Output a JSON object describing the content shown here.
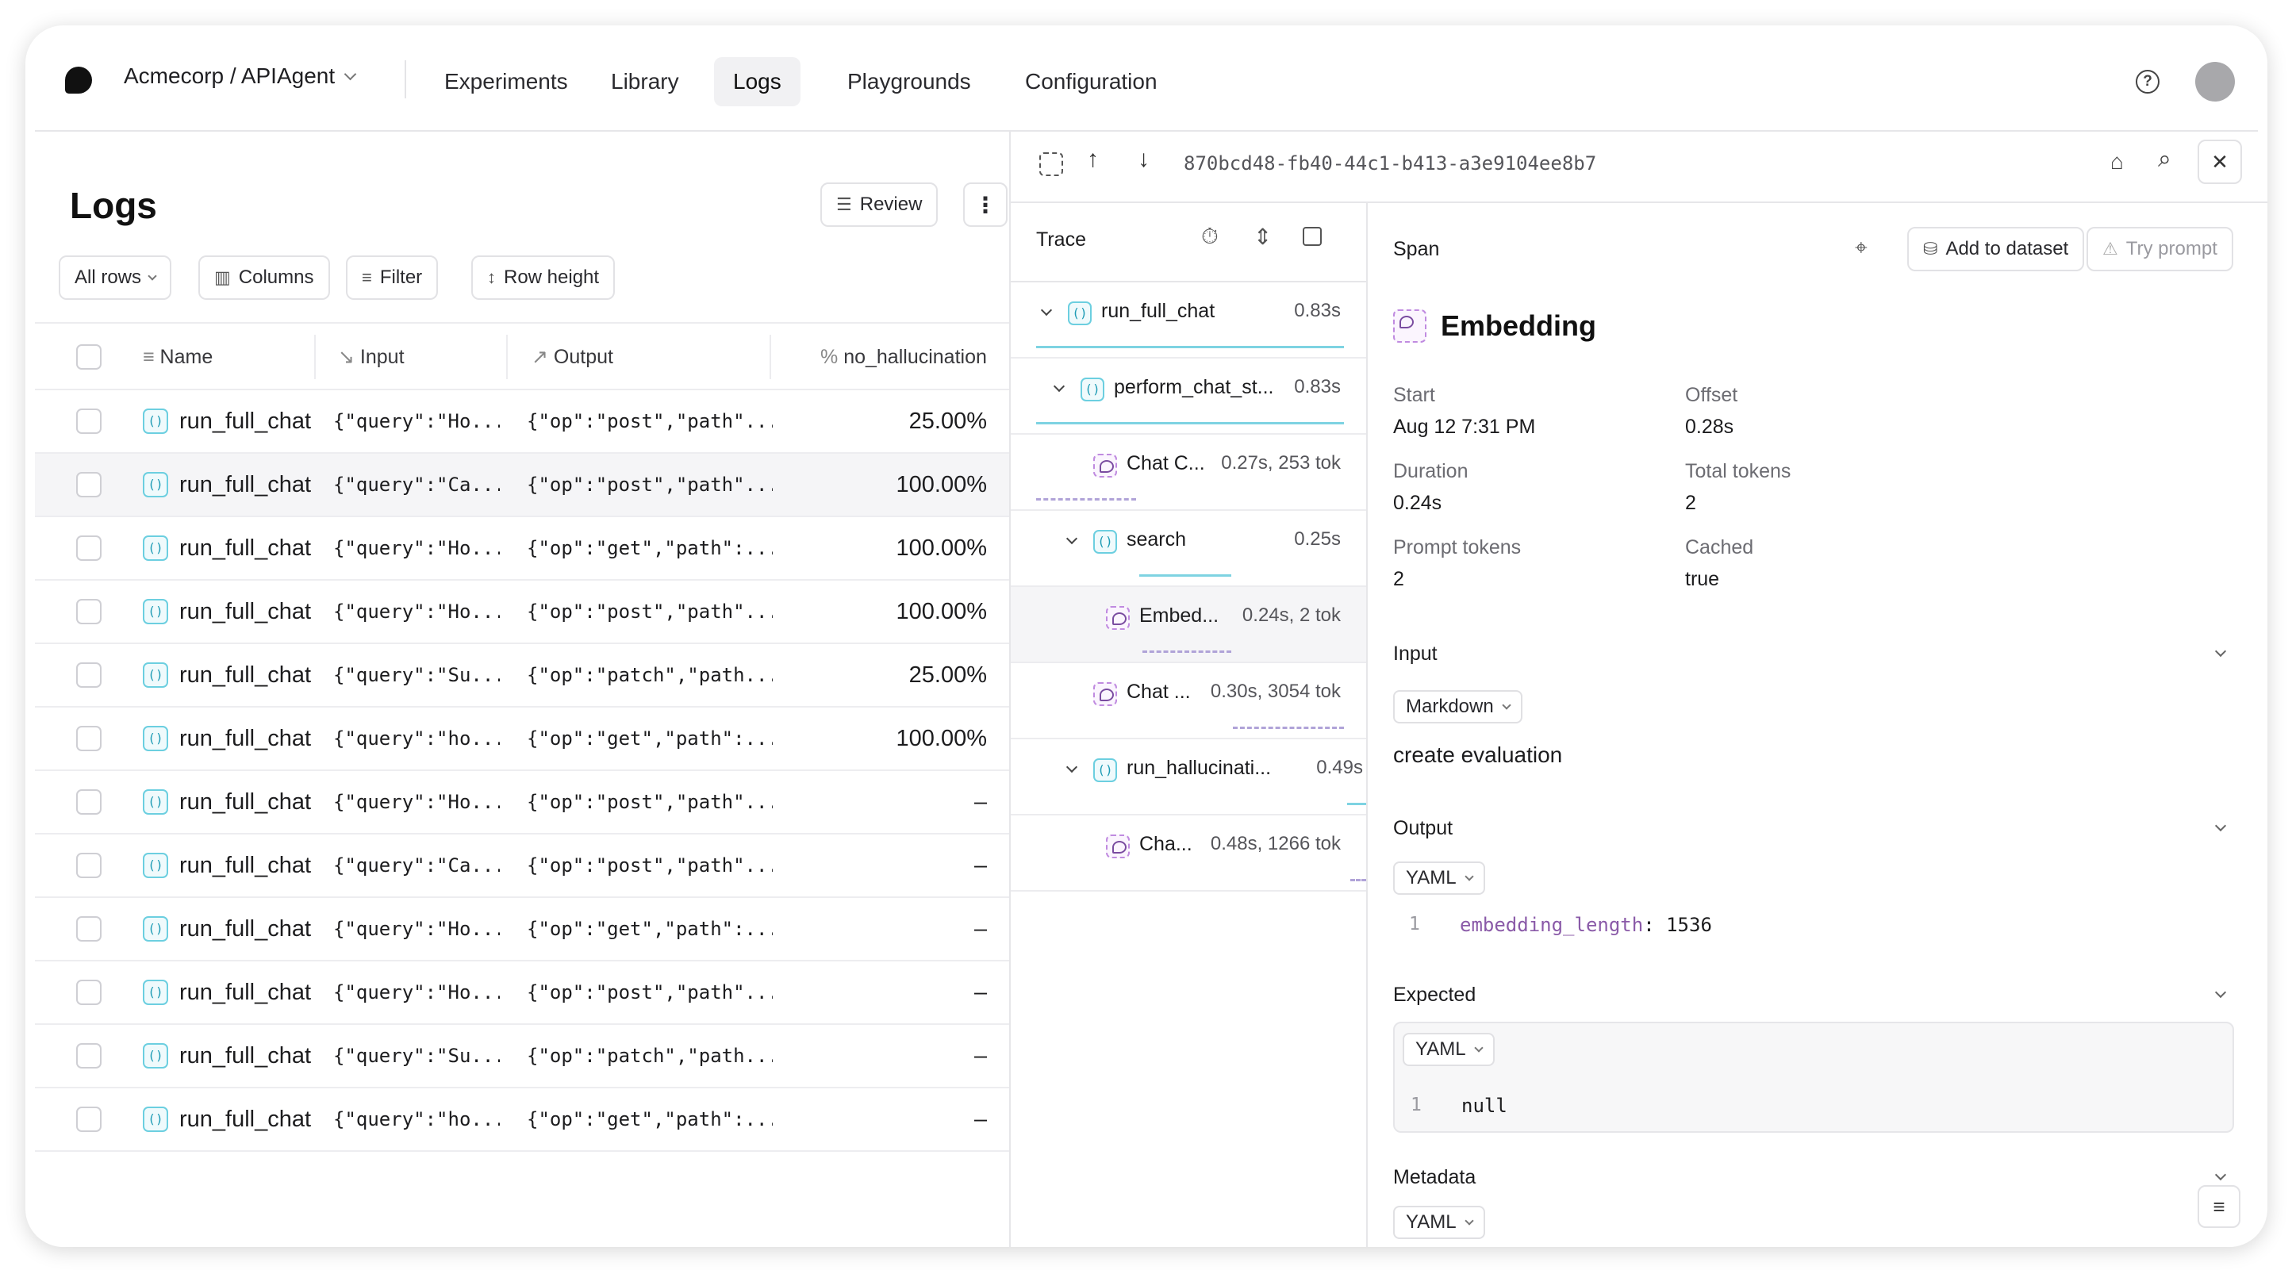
{
  "topbar": {
    "project": "Acmecorp / APIAgent",
    "nav": [
      "Experiments",
      "Library",
      "Logs",
      "Playgrounds",
      "Configuration"
    ],
    "active_nav": "Logs"
  },
  "logs": {
    "title": "Logs",
    "review_label": "Review",
    "filters": {
      "all_rows": "All rows",
      "columns": "Columns",
      "filter": "Filter",
      "row_height": "Row height"
    },
    "columns": {
      "name": "Name",
      "input": "Input",
      "output": "Output",
      "score": "no_hallucination"
    },
    "rows": [
      {
        "name": "run_full_chat",
        "input": "{\"query\":\"Ho...",
        "output": "{\"op\":\"post\",\"path\"...",
        "score": "25.00%"
      },
      {
        "name": "run_full_chat",
        "input": "{\"query\":\"Ca...",
        "output": "{\"op\":\"post\",\"path\"...",
        "score": "100.00%"
      },
      {
        "name": "run_full_chat",
        "input": "{\"query\":\"Ho...",
        "output": "{\"op\":\"get\",\"path\":...",
        "score": "100.00%"
      },
      {
        "name": "run_full_chat",
        "input": "{\"query\":\"Ho...",
        "output": "{\"op\":\"post\",\"path\"...",
        "score": "100.00%"
      },
      {
        "name": "run_full_chat",
        "input": "{\"query\":\"Su...",
        "output": "{\"op\":\"patch\",\"path...",
        "score": "25.00%"
      },
      {
        "name": "run_full_chat",
        "input": "{\"query\":\"ho...",
        "output": "{\"op\":\"get\",\"path\":...",
        "score": "100.00%"
      },
      {
        "name": "run_full_chat",
        "input": "{\"query\":\"Ho...",
        "output": "{\"op\":\"post\",\"path\"...",
        "score": "–"
      },
      {
        "name": "run_full_chat",
        "input": "{\"query\":\"Ca...",
        "output": "{\"op\":\"post\",\"path\"...",
        "score": "–"
      },
      {
        "name": "run_full_chat",
        "input": "{\"query\":\"Ho...",
        "output": "{\"op\":\"get\",\"path\":...",
        "score": "–"
      },
      {
        "name": "run_full_chat",
        "input": "{\"query\":\"Ho...",
        "output": "{\"op\":\"post\",\"path\"...",
        "score": "–"
      },
      {
        "name": "run_full_chat",
        "input": "{\"query\":\"Su...",
        "output": "{\"op\":\"patch\",\"path...",
        "score": "–"
      },
      {
        "name": "run_full_chat",
        "input": "{\"query\":\"ho...",
        "output": "{\"op\":\"get\",\"path\":...",
        "score": "–"
      }
    ]
  },
  "detail": {
    "trace_id": "870bcd48-fb40-44c1-b413-a3e9104ee8b7"
  },
  "trace": {
    "title": "Trace",
    "spans": [
      {
        "label": "run_full_chat",
        "duration": "0.83s"
      },
      {
        "label": "perform_chat_st...",
        "duration": "0.83s"
      },
      {
        "label": "Chat C...",
        "duration": "0.27s, 253 tok"
      },
      {
        "label": "search",
        "duration": "0.25s"
      },
      {
        "label": "Embed...",
        "duration": "0.24s, 2 tok"
      },
      {
        "label": "Chat ...",
        "duration": "0.30s, 3054 tok"
      },
      {
        "label": "run_hallucinati...",
        "duration": "0.49s"
      },
      {
        "label": "Cha...",
        "duration": "0.48s, 1266 tok"
      }
    ]
  },
  "span": {
    "header": "Span",
    "add_to_dataset": "Add to dataset",
    "try_prompt": "Try prompt",
    "name": "Embedding",
    "metrics": {
      "start_label": "Start",
      "start": "Aug 12 7:31 PM",
      "offset_label": "Offset",
      "offset": "0.28s",
      "duration_label": "Duration",
      "duration": "0.24s",
      "total_tokens_label": "Total tokens",
      "total_tokens": "2",
      "prompt_tokens_label": "Prompt tokens",
      "prompt_tokens": "2",
      "cached_label": "Cached",
      "cached": "true"
    },
    "input": {
      "label": "Input",
      "format": "Markdown",
      "text": "create evaluation"
    },
    "output": {
      "label": "Output",
      "format": "YAML",
      "line_no": "1",
      "key": "embedding_length",
      "sep": ":",
      "value": "1536"
    },
    "expected": {
      "label": "Expected",
      "format": "YAML",
      "line_no": "1",
      "value": "null"
    },
    "metadata": {
      "label": "Metadata",
      "format": "YAML"
    }
  }
}
